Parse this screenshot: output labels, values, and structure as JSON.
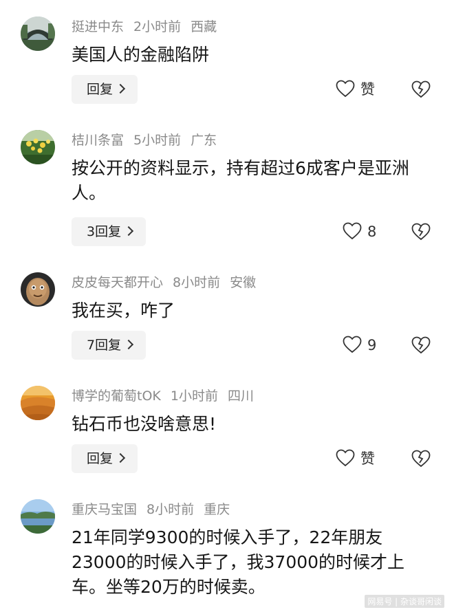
{
  "comments": [
    {
      "username": "挺进中东",
      "time": "2小时前",
      "location": "西藏",
      "text": "美国人的金融陷阱",
      "reply_label": "回复",
      "like_label": "赞",
      "avatar_icon": "bridge-landscape-avatar"
    },
    {
      "username": "桔川条富",
      "time": "5小时前",
      "location": "广东",
      "text": "按公开的资料显示，持有超过6成客户是亚洲人。",
      "reply_label": "3回复",
      "like_label": "8",
      "avatar_icon": "yellow-flowers-avatar"
    },
    {
      "username": "皮皮每天都开心",
      "time": "8小时前",
      "location": "安徽",
      "text": "我在买，咋了",
      "reply_label": "7回复",
      "like_label": "9",
      "avatar_icon": "potato-face-avatar"
    },
    {
      "username": "博学的葡萄tOK",
      "time": "1小时前",
      "location": "四川",
      "text": "钻石币也没啥意思!",
      "reply_label": "回复",
      "like_label": "赞",
      "avatar_icon": "desert-dunes-avatar"
    },
    {
      "username": "重庆马宝国",
      "time": "8小时前",
      "location": "重庆",
      "text": "21年同学9300的时候入手了，22年朋友23000的时候入手了，我37000的时候才上车。坐等20万的时候卖。",
      "reply_label": "",
      "like_label": "",
      "avatar_icon": "lake-landscape-avatar"
    }
  ],
  "watermark": "网易号 | 杂谈哥闲谈",
  "colors": {
    "meta_text": "#8a8a8a",
    "body_text": "#161616",
    "button_bg": "#f3f3f3"
  }
}
